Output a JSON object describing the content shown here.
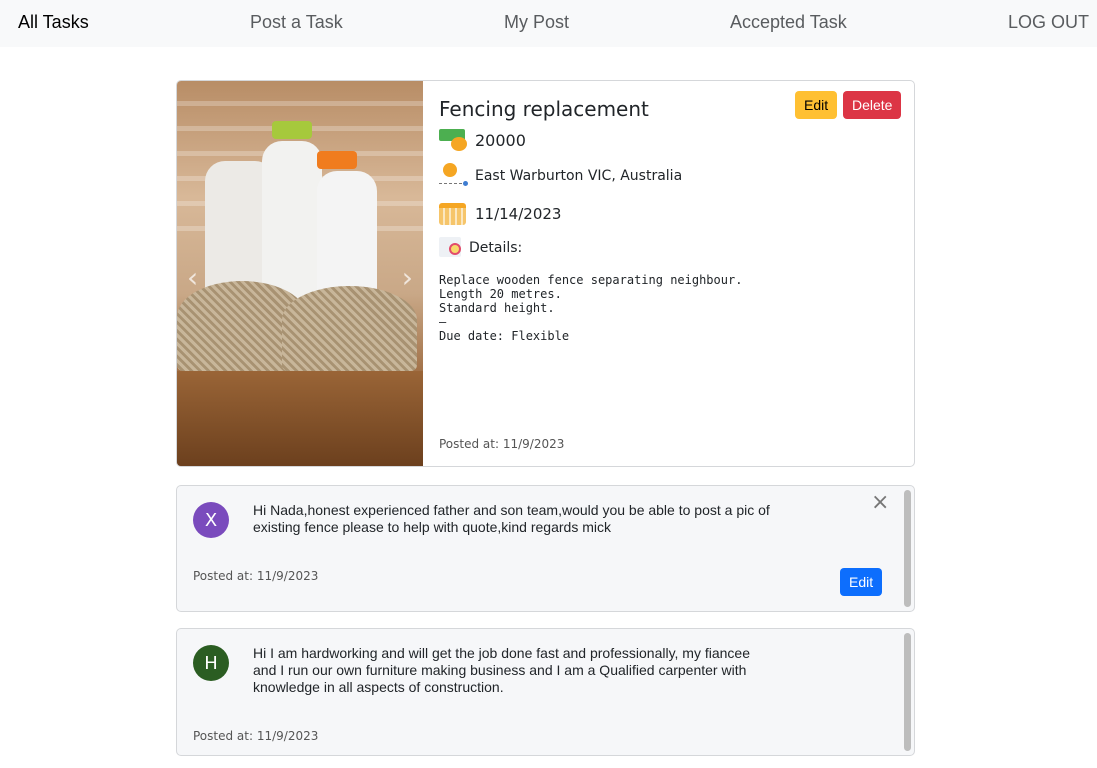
{
  "nav": {
    "all_tasks": "All Tasks",
    "post_task": "Post a Task",
    "my_post": "My Post",
    "accepted_task": "Accepted Task",
    "logout": "LOG OUT"
  },
  "task": {
    "title": "Fencing replacement",
    "price": "20000",
    "location": "East Warburton VIC, Australia",
    "date": "11/14/2023",
    "details_label": "Details:",
    "details": "Replace wooden fence separating neighbour.\nLength 20 metres.\nStandard height.\n–\nDue date: Flexible",
    "posted": "Posted at: 11/9/2023",
    "edit_label": "Edit",
    "delete_label": "Delete"
  },
  "comments": [
    {
      "initial": "X",
      "color": "#7a4bbd",
      "text": "Hi Nada,honest experienced father and son team,would you be able to post a pic of existing fence please to help with quote,kind regards mick",
      "posted": "Posted at: 11/9/2023",
      "edit_label": "Edit"
    },
    {
      "initial": "H",
      "color": "#2b5d22",
      "text": "Hi I am hardworking and will get the job done fast and professionally, my fiancee and I run our own furniture making business and I am a Qualified carpenter with knowledge in all aspects of construction.",
      "posted": "Posted at: 11/9/2023"
    }
  ]
}
